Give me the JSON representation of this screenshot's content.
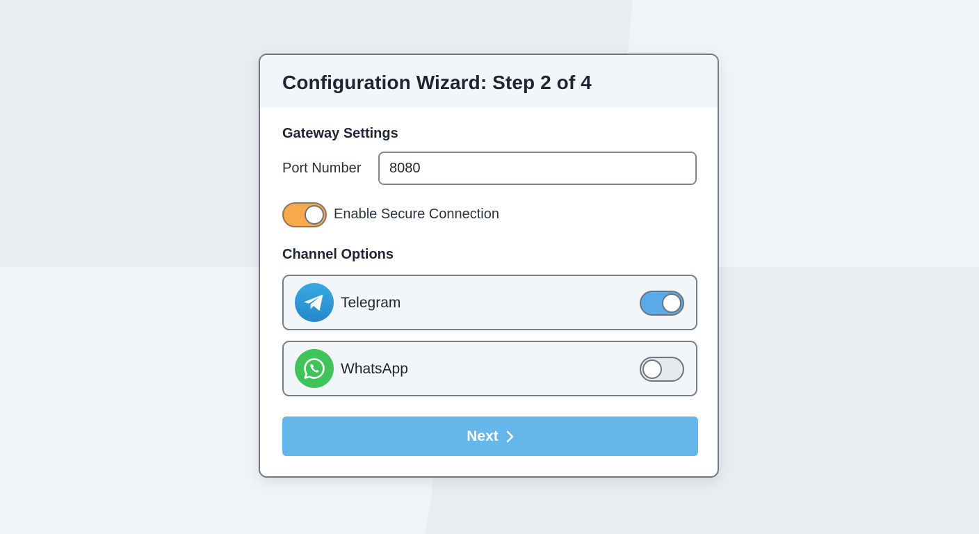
{
  "wizard": {
    "title": "Configuration Wizard: Step 2 of 4"
  },
  "gateway": {
    "section_title": "Gateway Settings",
    "port_label": "Port Number",
    "port_value": "8080",
    "secure_label": "Enable Secure Connection",
    "secure_enabled": true
  },
  "channels": {
    "section_title": "Channel Options",
    "items": [
      {
        "name": "Telegram",
        "icon": "telegram-icon",
        "enabled": true
      },
      {
        "name": "WhatsApp",
        "icon": "whatsapp-icon",
        "enabled": false
      }
    ]
  },
  "actions": {
    "next_label": "Next",
    "next_icon": "chevron-right-icon"
  },
  "colors": {
    "accent_blue": "#65b6ea",
    "toggle_on_blue": "#5aa9e8",
    "toggle_orange": "#f7a94c",
    "telegram_blue": "#2e9fd8",
    "whatsapp_green": "#3fc35a"
  }
}
